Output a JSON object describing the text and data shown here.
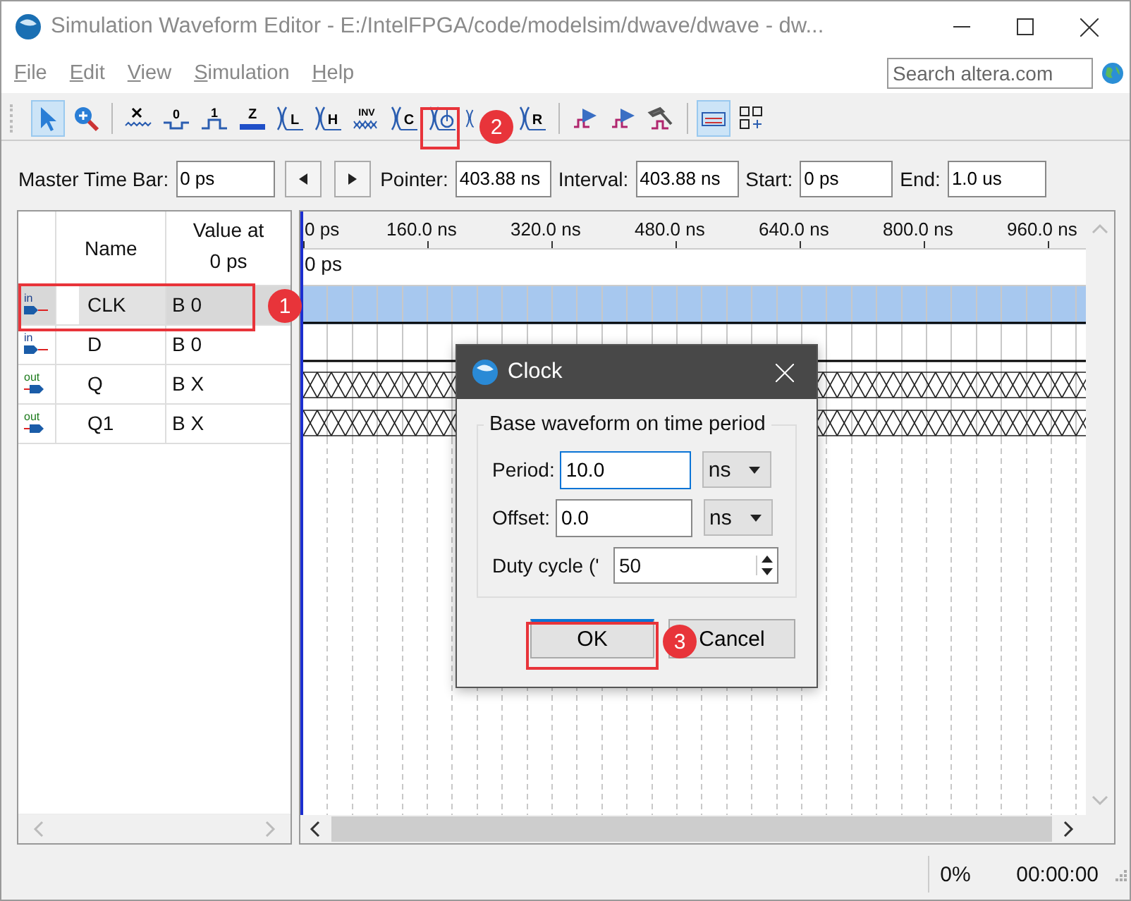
{
  "window": {
    "title": "Simulation Waveform Editor - E:/IntelFPGA/code/modelsim/dwave/dwave - dw..."
  },
  "menu": [
    "File",
    "Edit",
    "View",
    "Simulation",
    "Help"
  ],
  "search": {
    "placeholder": "Search altera.com"
  },
  "toolbar": [
    {
      "kind": "pointer",
      "selected": true
    },
    {
      "kind": "zoom",
      "selected": false
    },
    {
      "kind": "sep"
    },
    {
      "kind": "unknown",
      "selected": false
    },
    {
      "kind": "low",
      "glyph": "0",
      "selected": false
    },
    {
      "kind": "high",
      "glyph": "1",
      "selected": false
    },
    {
      "kind": "z",
      "glyph": "Z",
      "selected": false
    },
    {
      "kind": "xletter",
      "glyph": "L",
      "selected": false
    },
    {
      "kind": "xletter",
      "glyph": "H",
      "selected": false
    },
    {
      "kind": "inv",
      "glyph": "INV",
      "selected": false
    },
    {
      "kind": "xletter",
      "glyph": "C",
      "selected": false
    },
    {
      "kind": "clock",
      "selected": false
    },
    {
      "kind": "xletter",
      "selected": false
    },
    {
      "kind": "xletter",
      "glyph": "R",
      "selected": false
    },
    {
      "kind": "sep"
    },
    {
      "kind": "sim",
      "selected": false
    },
    {
      "kind": "sim",
      "selected": false
    },
    {
      "kind": "hammer",
      "selected": false
    },
    {
      "kind": "sep"
    },
    {
      "kind": "snap",
      "selected": true
    },
    {
      "kind": "grid",
      "selected": false
    }
  ],
  "time_bar": {
    "master_label": "Master Time Bar:",
    "master_value": "0 ps",
    "pointer_label": "Pointer:",
    "pointer_value": "403.88 ns",
    "interval_label": "Interval:",
    "interval_value": "403.88 ns",
    "start_label": "Start:",
    "start_value": "0 ps",
    "end_label": "End:",
    "end_value": "1.0 us"
  },
  "signal_table": {
    "name_header": "Name",
    "value_header_1": "Value at",
    "value_header_2": "0 ps"
  },
  "signals": [
    {
      "direction": "in",
      "name": "CLK",
      "value": "B 0",
      "selected": true,
      "kind": "low"
    },
    {
      "direction": "in",
      "name": "D",
      "value": "B 0",
      "selected": false,
      "kind": "low"
    },
    {
      "direction": "out",
      "name": "Q",
      "value": "B X",
      "selected": false,
      "kind": "unknown"
    },
    {
      "direction": "out",
      "name": "Q1",
      "value": "B X",
      "selected": false,
      "kind": "unknown"
    }
  ],
  "ruler": [
    "0 ps",
    "160.0 ns",
    "320.0 ns",
    "480.0 ns",
    "640.0 ns",
    "800.0 ns",
    "960.0 ns"
  ],
  "cursor_time": "0 ps",
  "dialog": {
    "title": "Clock",
    "group": "Base waveform on time period",
    "period_label": "Period:",
    "period_value": "10.0",
    "period_unit": "ns",
    "offset_label": "Offset:",
    "offset_value": "0.0",
    "offset_unit": "ns",
    "duty_label": "Duty cycle ('",
    "duty_value": "50",
    "ok": "OK",
    "cancel": "Cancel"
  },
  "annotations": [
    "1",
    "2",
    "3"
  ],
  "status_bar": {
    "progress": "0%",
    "elapsed": "00:00:00"
  }
}
